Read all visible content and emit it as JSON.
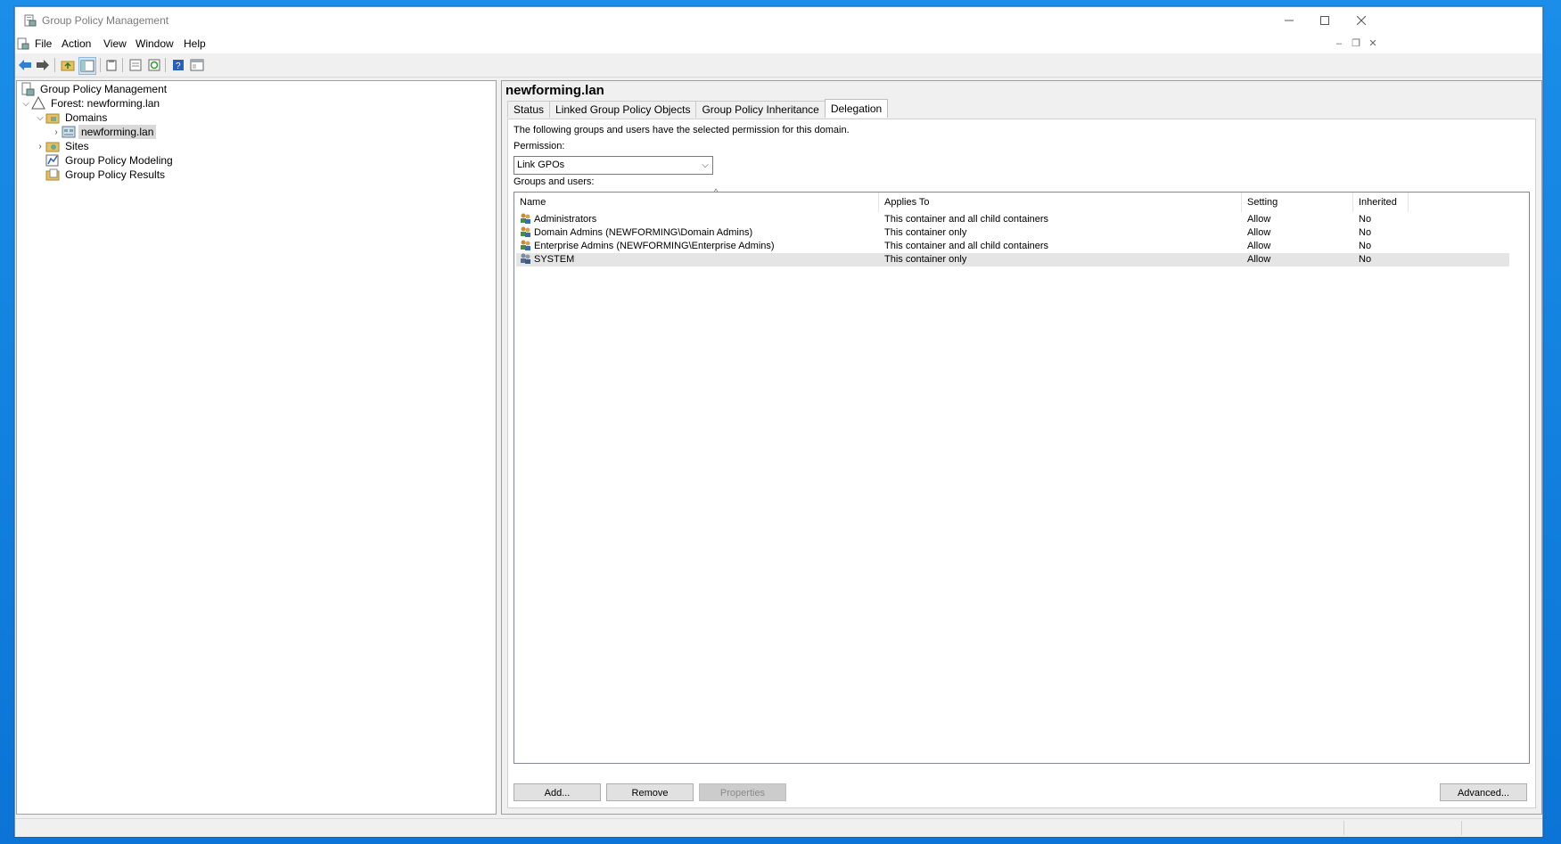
{
  "window": {
    "title": "Group Policy Management"
  },
  "menu": [
    "File",
    "Action",
    "View",
    "Window",
    "Help"
  ],
  "tree": {
    "root": "Group Policy Management",
    "forest": "Forest: newforming.lan",
    "domains": "Domains",
    "domain": "newforming.lan",
    "sites": "Sites",
    "modeling": "Group Policy Modeling",
    "results": "Group Policy Results"
  },
  "detail": {
    "title": "newforming.lan",
    "tabs": [
      "Status",
      "Linked Group Policy Objects",
      "Group Policy Inheritance",
      "Delegation"
    ],
    "active_tab": "Delegation",
    "description": "The following groups and users have the selected permission for this domain.",
    "permission_label": "Permission:",
    "permission_value": "Link GPOs",
    "groups_label": "Groups and users:",
    "columns": [
      "Name",
      "Applies To",
      "Setting",
      "Inherited"
    ],
    "rows": [
      {
        "name": "Administrators",
        "applies": "This container and all child containers",
        "setting": "Allow",
        "inherited": "No"
      },
      {
        "name": "Domain Admins (NEWFORMING\\Domain Admins)",
        "applies": "This container only",
        "setting": "Allow",
        "inherited": "No"
      },
      {
        "name": "Enterprise Admins (NEWFORMING\\Enterprise Admins)",
        "applies": "This container and all child containers",
        "setting": "Allow",
        "inherited": "No"
      },
      {
        "name": "SYSTEM",
        "applies": "This container only",
        "setting": "Allow",
        "inherited": "No"
      }
    ],
    "buttons": {
      "add": "Add...",
      "remove": "Remove",
      "properties": "Properties",
      "advanced": "Advanced..."
    }
  },
  "colors": {
    "accent": "#0b74d6",
    "selection": "#d9d9d9"
  }
}
